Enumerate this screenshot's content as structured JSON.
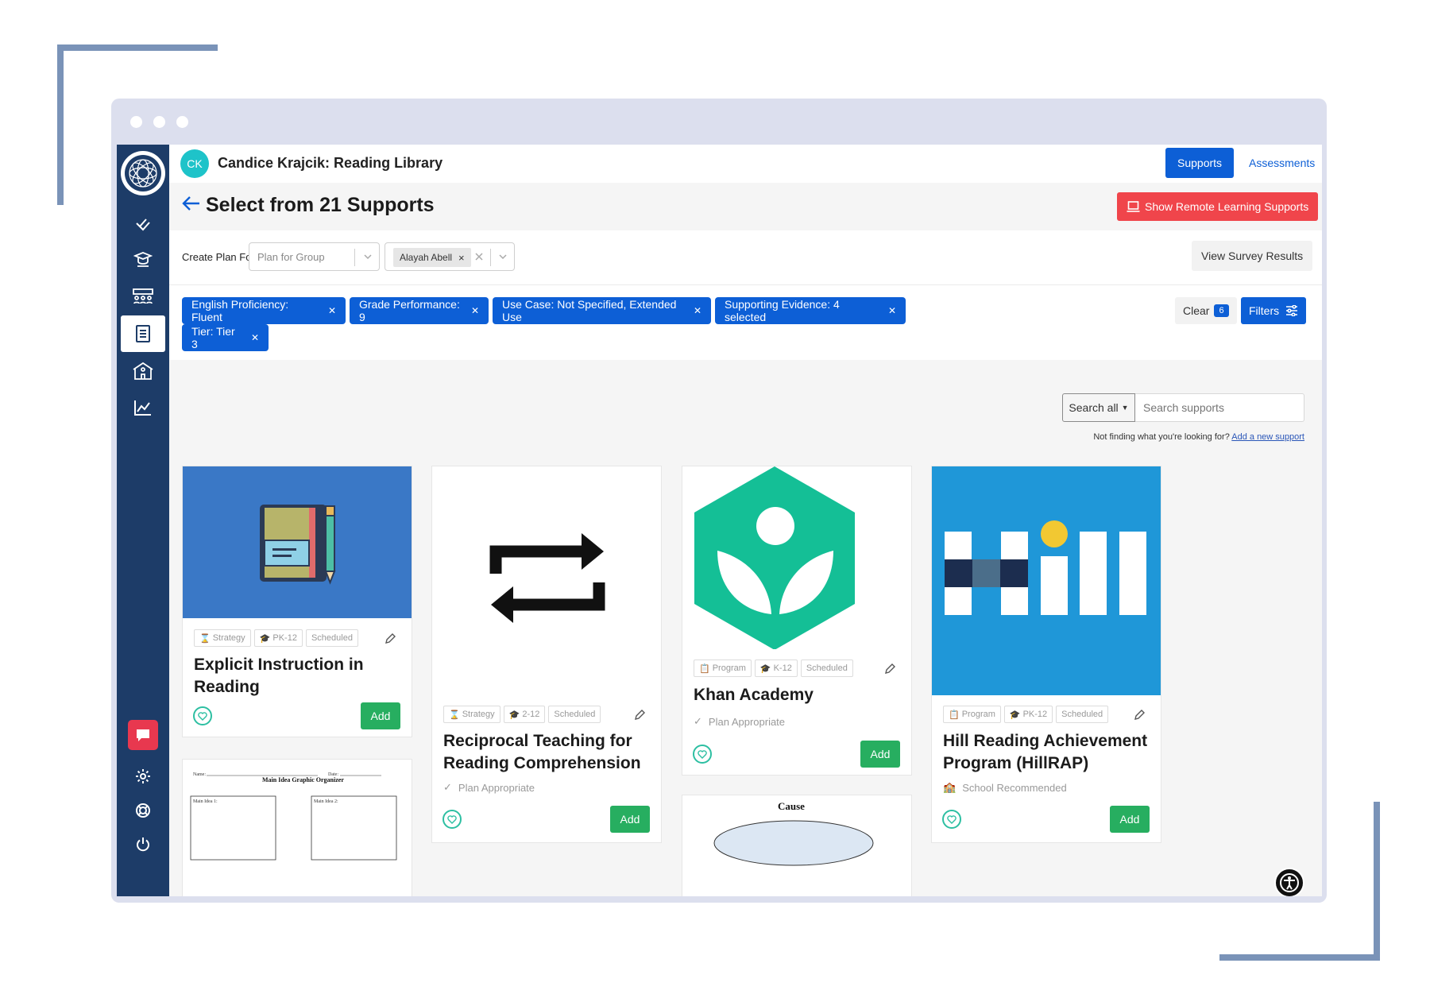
{
  "header": {
    "avatar_initials": "CK",
    "library_title": "Candice Krajcik: Reading Library",
    "supports_tab": "Supports",
    "assessments_tab": "Assessments"
  },
  "page": {
    "title": "Select from 21 Supports",
    "remote_button": "Show Remote Learning Supports"
  },
  "plan": {
    "label": "Create Plan For",
    "plan_select_value": "Plan for Group",
    "student_chip": "Alayah Abell",
    "survey_button": "View Survey Results"
  },
  "filters": {
    "chips": [
      "English Proficiency: Fluent",
      "Grade Performance: 9",
      "Use Case: Not Specified, Extended Use",
      "Supporting Evidence: 4 selected",
      "Tier: Tier 3"
    ],
    "clear_label": "Clear",
    "clear_count": "6",
    "filters_label": "Filters"
  },
  "search": {
    "scope": "Search all",
    "placeholder": "Search supports",
    "not_finding": "Not finding what you're looking for?",
    "add_new_link": "Add a new support"
  },
  "cards": [
    {
      "title": "Explicit Instruction in Reading",
      "type": "Strategy",
      "grades": "PK-12",
      "schedule": "Scheduled",
      "status": "",
      "add": "Add"
    },
    {
      "title": "Reciprocal Teaching for Reading Comprehension",
      "type": "Strategy",
      "grades": "2-12",
      "schedule": "Scheduled",
      "status": "Plan Appropriate",
      "add": "Add"
    },
    {
      "title": "Khan Academy",
      "type": "Program",
      "grades": "K-12",
      "schedule": "Scheduled",
      "status": "Plan Appropriate",
      "add": "Add"
    },
    {
      "title": "Hill Reading Achievement Program (HillRAP)",
      "type": "Program",
      "grades": "PK-12",
      "schedule": "Scheduled",
      "status": "School Recommended",
      "add": "Add"
    }
  ],
  "partial_cards": {
    "organizer_title": "Main Idea Graphic Organizer",
    "organizer_name": "Name:",
    "organizer_date": "Date:",
    "organizer_box1": "Main Idea 1:",
    "organizer_box2": "Main Idea 2:",
    "cause_label": "Cause"
  },
  "colors": {
    "brand_blue": "#0d5fd6",
    "sidebar": "#1d3c68",
    "remote_red": "#f0454b",
    "add_green": "#27ae60",
    "khan_green": "#14bf96",
    "hill_blue": "#1f97d8"
  }
}
